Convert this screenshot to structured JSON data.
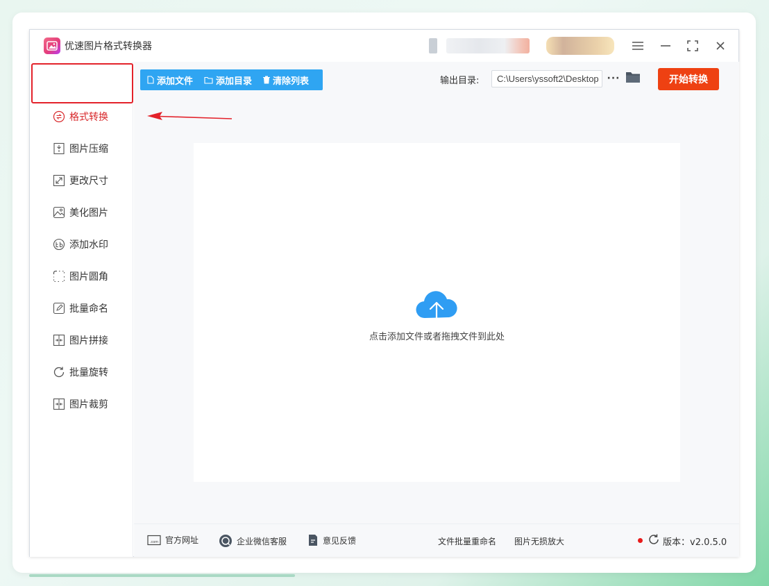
{
  "app": {
    "title": "优速图片格式转换器"
  },
  "window_controls": {
    "menu": "menu-icon",
    "minimize": "minimize-icon",
    "maximize": "maximize-icon",
    "close": "close-icon"
  },
  "toolbar": {
    "add_file": "添加文件",
    "add_folder": "添加目录",
    "clear_list": "清除列表",
    "output_label": "输出目录:",
    "output_path": "C:\\Users\\yssoft2\\Desktop",
    "more": "···",
    "start": "开始转换"
  },
  "sidebar": {
    "items": [
      {
        "label": "格式转换",
        "icon": "format-convert-icon",
        "active": true
      },
      {
        "label": "图片压缩",
        "icon": "compress-icon"
      },
      {
        "label": "更改尺寸",
        "icon": "resize-icon"
      },
      {
        "label": "美化图片",
        "icon": "beautify-icon"
      },
      {
        "label": "添加水印",
        "icon": "watermark-icon"
      },
      {
        "label": "图片圆角",
        "icon": "round-corner-icon"
      },
      {
        "label": "批量命名",
        "icon": "rename-icon"
      },
      {
        "label": "图片拼接",
        "icon": "stitch-icon"
      },
      {
        "label": "批量旋转",
        "icon": "rotate-icon"
      },
      {
        "label": "图片裁剪",
        "icon": "crop-icon"
      }
    ]
  },
  "dropzone": {
    "text": "点击添加文件或者拖拽文件到此处"
  },
  "footer": {
    "website": "官方网址",
    "wechat": "企业微信客服",
    "feedback": "意见反馈",
    "batch_rename": "文件批量重命名",
    "lossless": "图片无损放大",
    "version": "版本：v2.0.5.0"
  },
  "colors": {
    "accent_blue": "#2fa5f2",
    "start_red": "#ee4112",
    "active_red": "#d8282b"
  }
}
